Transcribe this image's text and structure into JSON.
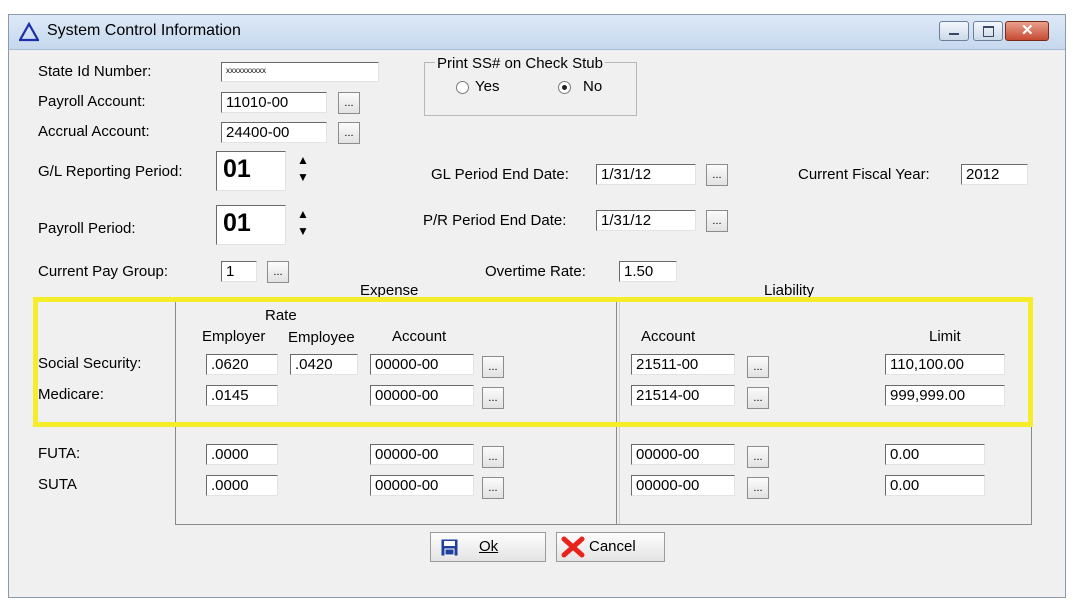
{
  "window": {
    "title": "System Control Information"
  },
  "fields": {
    "state_id_label": "State Id Number:",
    "state_id_value": "xxxxxxxxxx",
    "payroll_account_label": "Payroll Account:",
    "payroll_account_value": "11010-00",
    "accrual_account_label": "Accrual Account:",
    "accrual_account_value": "24400-00",
    "gl_reporting_label": "G/L Reporting Period:",
    "gl_reporting_value": "01",
    "payroll_period_label": "Payroll Period:",
    "payroll_period_value": "01",
    "current_pay_group_label": "Current Pay Group:",
    "current_pay_group_value": "1",
    "gl_end_date_label": "GL Period End Date:",
    "gl_end_date_value": "1/31/12",
    "pr_end_date_label": "P/R Period End Date:",
    "pr_end_date_value": "1/31/12",
    "fiscal_year_label": "Current Fiscal Year:",
    "fiscal_year_value": "2012",
    "overtime_rate_label": "Overtime Rate:",
    "overtime_rate_value": "1.50"
  },
  "print_ss": {
    "title": "Print SS# on Check Stub",
    "options": [
      "Yes",
      "No"
    ],
    "selected": "No"
  },
  "ellipsis": "...",
  "tax_grid": {
    "expense_header": "Expense",
    "liability_header": "Liability",
    "rate_header": "Rate",
    "employer_header": "Employer",
    "employee_header": "Employee",
    "account_header": "Account",
    "liab_account_header": "Account",
    "limit_header": "Limit",
    "rows": [
      {
        "label": "Social Security:",
        "employer": ".0620",
        "employee": ".0420",
        "account": "00000-00",
        "liab_account": "21511-00",
        "limit": "110,100.00"
      },
      {
        "label": "Medicare:",
        "employer": ".0145",
        "employee": "",
        "account": "00000-00",
        "liab_account": "21514-00",
        "limit": "999,999.00"
      },
      {
        "label": "FUTA:",
        "employer": ".0000",
        "employee": "",
        "account": "00000-00",
        "liab_account": "00000-00",
        "limit": "0.00"
      },
      {
        "label": "SUTA",
        "employer": ".0000",
        "employee": "",
        "account": "00000-00",
        "liab_account": "00000-00",
        "limit": "0.00"
      }
    ]
  },
  "buttons": {
    "ok": "Ok",
    "cancel": "Cancel"
  },
  "colors": {
    "highlight": "#f5ec2a",
    "cancel_x": "#e8231c",
    "save_icon": "#1f3f9a"
  },
  "icons": {
    "title": "triangle-icon",
    "ok": "floppy-disk-icon",
    "cancel": "red-x-icon"
  }
}
